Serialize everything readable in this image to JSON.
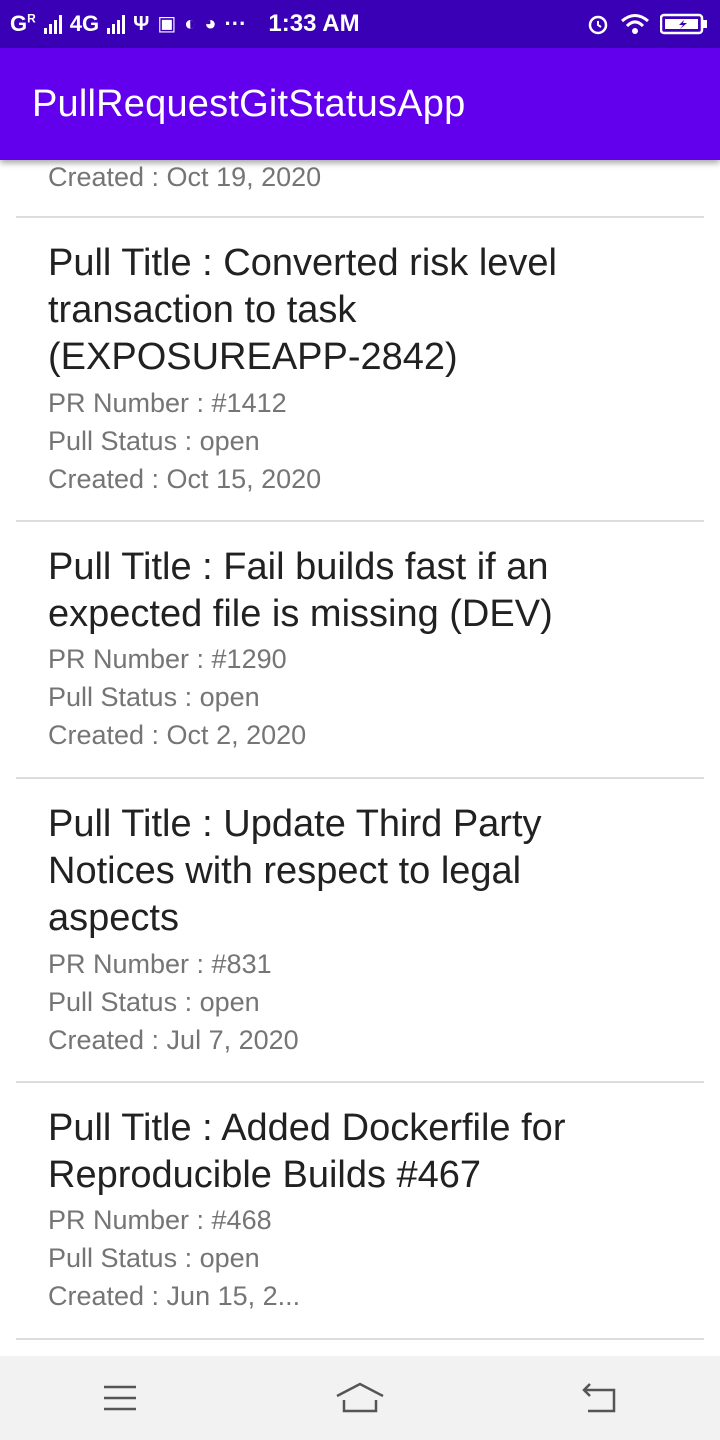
{
  "status_bar": {
    "carrier_left": "G",
    "carrier_super": "R",
    "network": "4G",
    "time": "1:33 AM",
    "more": "···"
  },
  "app_bar": {
    "title": "PullRequestGitStatusApp"
  },
  "pull_requests": [
    {
      "title": "",
      "pr_number": "",
      "status": "",
      "created": "Created : Oct 19, 2020"
    },
    {
      "title": "Pull Title : Converted risk level transaction to task (EXPOSUREAPP-2842)",
      "pr_number": "PR Number : #1412",
      "status": "Pull Status : open",
      "created": "Created : Oct 15, 2020"
    },
    {
      "title": "Pull Title : Fail builds fast if an expected file is missing (DEV)",
      "pr_number": "PR Number : #1290",
      "status": "Pull Status : open",
      "created": "Created : Oct 2, 2020"
    },
    {
      "title": "Pull Title : Update Third Party Notices with respect to legal aspects",
      "pr_number": "PR Number : #831",
      "status": "Pull Status : open",
      "created": "Created : Jul 7, 2020"
    },
    {
      "title": "Pull Title : Added Dockerfile for Reproducible Builds #467",
      "pr_number": "PR Number : #468",
      "status": "Pull Status : open",
      "created": "Created : Jun 15, 2..."
    }
  ],
  "nav_bar": {
    "menu_icon": "menu-icon",
    "home_icon": "home-icon",
    "back_icon": "back-icon"
  },
  "colors": {
    "status_bar": "#3a00b5",
    "app_bar": "#6200ee",
    "title_text": "#212121",
    "meta_text": "#757575",
    "divider": "#dcdcdc"
  }
}
